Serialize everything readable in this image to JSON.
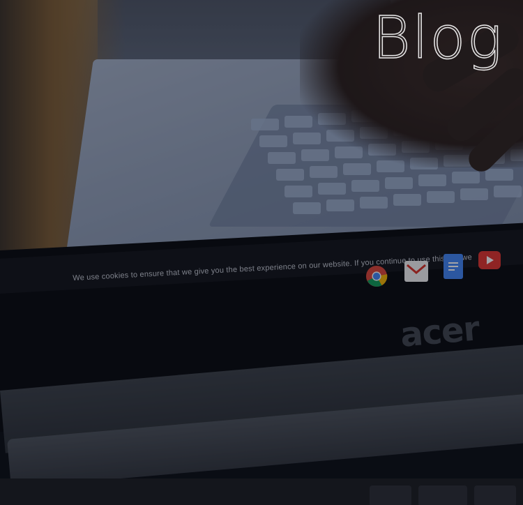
{
  "page": {
    "title": "Blog"
  },
  "photo": {
    "cookie_banner_text": "We use cookies to ensure that we give you the best experience on our website. If you continue to use this site we",
    "brand_logo": "acer",
    "shelf_icons": [
      "chrome-icon",
      "gmail-icon",
      "docs-icon",
      "youtube-icon"
    ]
  },
  "colors": {
    "title_stroke": "#ffffff",
    "chrome_red": "#db4437",
    "chrome_yellow": "#f4b400",
    "chrome_green": "#0f9d58",
    "chrome_blue": "#4285f4",
    "youtube_red": "#e0322c"
  }
}
